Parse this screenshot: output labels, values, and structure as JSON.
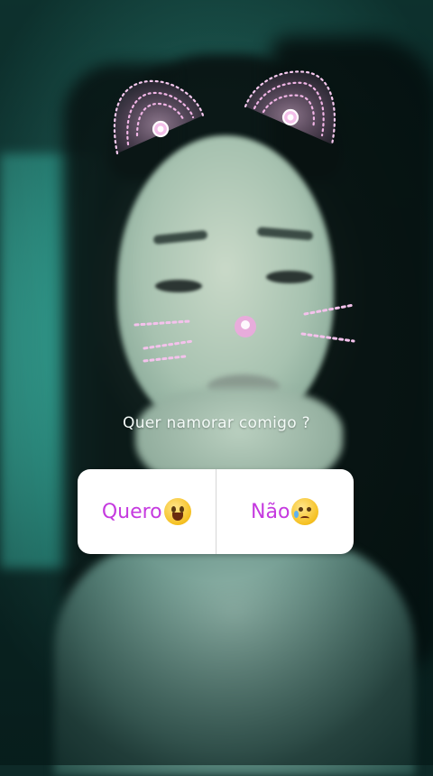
{
  "story": {
    "question": "Quer namorar comigo ?",
    "poll": {
      "option_yes": "Quero",
      "option_no": "Não",
      "option_yes_emoji": "smiling-face-icon",
      "option_no_emoji": "sad-face-icon"
    },
    "filter": "cat-ears-and-whiskers"
  },
  "colors": {
    "poll_text": "#c53adf",
    "filter_pink": "#f1b5e6"
  }
}
